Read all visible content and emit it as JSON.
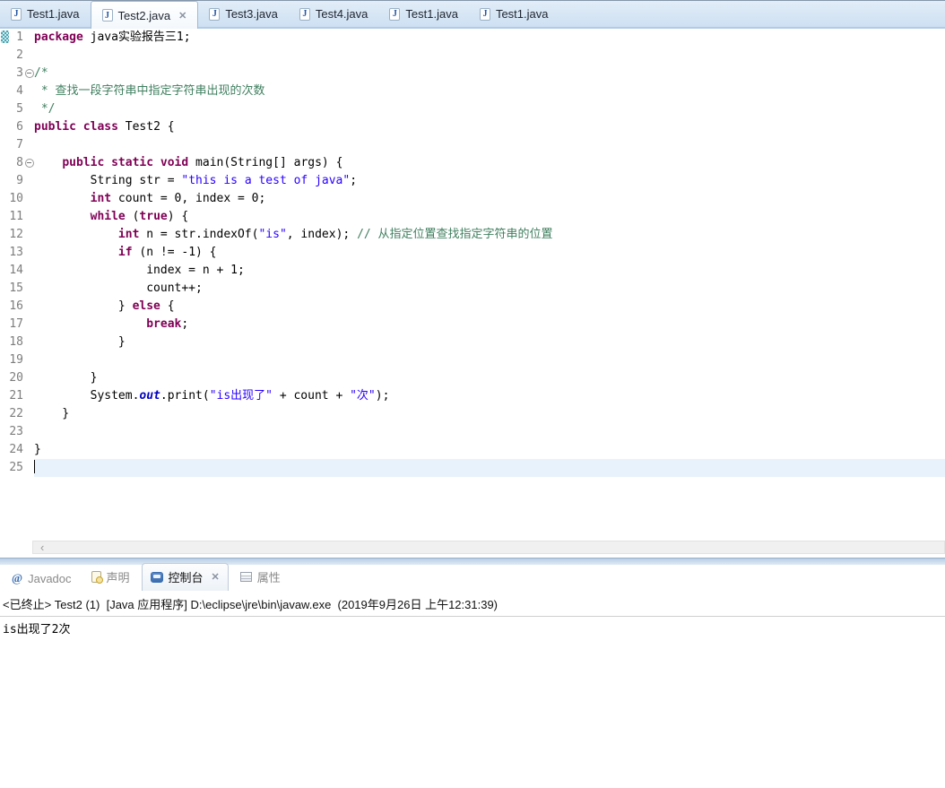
{
  "icons": {
    "close_glyph": "✕",
    "chevron_left_glyph": "‹",
    "java_file_glyph": "J",
    "javadoc_glyph": "@"
  },
  "colors": {
    "keyword": "#7f0055",
    "string": "#2a00ff",
    "comment": "#3f7f5f",
    "static_field": "#0000c0",
    "line_number": "#7d7d7d",
    "current_line_bg": "#e8f2fc",
    "tabbar_bg": "#cde0f2"
  },
  "editor_tabs": [
    {
      "label": "Test1.java",
      "active": false
    },
    {
      "label": "Test2.java",
      "active": true
    },
    {
      "label": "Test3.java",
      "active": false
    },
    {
      "label": "Test4.java",
      "active": false
    },
    {
      "label": "Test1.java",
      "active": false
    },
    {
      "label": "Test1.java",
      "active": false
    }
  ],
  "code": {
    "lines": [
      {
        "n": 1,
        "fold": false,
        "segs": [
          [
            "kw",
            "package"
          ],
          [
            "pl",
            " java实验报告三1;"
          ]
        ]
      },
      {
        "n": 2,
        "fold": false,
        "segs": []
      },
      {
        "n": 3,
        "fold": true,
        "segs": [
          [
            "com",
            "/*"
          ]
        ]
      },
      {
        "n": 4,
        "fold": false,
        "segs": [
          [
            "com",
            " * 查找一段字符串中指定字符串出现的次数"
          ]
        ]
      },
      {
        "n": 5,
        "fold": false,
        "segs": [
          [
            "com",
            " */"
          ]
        ]
      },
      {
        "n": 6,
        "fold": false,
        "segs": [
          [
            "kw",
            "public"
          ],
          [
            "pl",
            " "
          ],
          [
            "kw",
            "class"
          ],
          [
            "pl",
            " Test2 {"
          ]
        ]
      },
      {
        "n": 7,
        "fold": false,
        "segs": []
      },
      {
        "n": 8,
        "fold": true,
        "segs": [
          [
            "pl",
            "    "
          ],
          [
            "kw",
            "public"
          ],
          [
            "pl",
            " "
          ],
          [
            "kw",
            "static"
          ],
          [
            "pl",
            " "
          ],
          [
            "kw",
            "void"
          ],
          [
            "pl",
            " main(String[] args) {"
          ]
        ]
      },
      {
        "n": 9,
        "fold": false,
        "segs": [
          [
            "pl",
            "        String str = "
          ],
          [
            "str",
            "\"this is a test of java\""
          ],
          [
            "pl",
            ";"
          ]
        ]
      },
      {
        "n": 10,
        "fold": false,
        "segs": [
          [
            "pl",
            "        "
          ],
          [
            "kw",
            "int"
          ],
          [
            "pl",
            " count = 0, index = 0;"
          ]
        ]
      },
      {
        "n": 11,
        "fold": false,
        "segs": [
          [
            "pl",
            "        "
          ],
          [
            "kw",
            "while"
          ],
          [
            "pl",
            " ("
          ],
          [
            "kw",
            "true"
          ],
          [
            "pl",
            ") {"
          ]
        ]
      },
      {
        "n": 12,
        "fold": false,
        "segs": [
          [
            "pl",
            "            "
          ],
          [
            "kw",
            "int"
          ],
          [
            "pl",
            " n = str.indexOf("
          ],
          [
            "str",
            "\"is\""
          ],
          [
            "pl",
            ", index); "
          ],
          [
            "com",
            "// 从指定位置查找指定字符串的位置"
          ]
        ]
      },
      {
        "n": 13,
        "fold": false,
        "segs": [
          [
            "pl",
            "            "
          ],
          [
            "kw",
            "if"
          ],
          [
            "pl",
            " (n != -1) {"
          ]
        ]
      },
      {
        "n": 14,
        "fold": false,
        "segs": [
          [
            "pl",
            "                index = n + 1;"
          ]
        ]
      },
      {
        "n": 15,
        "fold": false,
        "segs": [
          [
            "pl",
            "                count++;"
          ]
        ]
      },
      {
        "n": 16,
        "fold": false,
        "segs": [
          [
            "pl",
            "            } "
          ],
          [
            "kw",
            "else"
          ],
          [
            "pl",
            " {"
          ]
        ]
      },
      {
        "n": 17,
        "fold": false,
        "segs": [
          [
            "pl",
            "                "
          ],
          [
            "kw",
            "break"
          ],
          [
            "pl",
            ";"
          ]
        ]
      },
      {
        "n": 18,
        "fold": false,
        "segs": [
          [
            "pl",
            "            }"
          ]
        ]
      },
      {
        "n": 19,
        "fold": false,
        "segs": []
      },
      {
        "n": 20,
        "fold": false,
        "segs": [
          [
            "pl",
            "        }"
          ]
        ]
      },
      {
        "n": 21,
        "fold": false,
        "segs": [
          [
            "pl",
            "        System."
          ],
          [
            "fld",
            "out"
          ],
          [
            "pl",
            ".print("
          ],
          [
            "str",
            "\"is出现了\""
          ],
          [
            "pl",
            " + count + "
          ],
          [
            "str",
            "\"次\""
          ],
          [
            "pl",
            ");"
          ]
        ]
      },
      {
        "n": 22,
        "fold": false,
        "segs": [
          [
            "pl",
            "    }"
          ]
        ]
      },
      {
        "n": 23,
        "fold": false,
        "segs": []
      },
      {
        "n": 24,
        "fold": false,
        "segs": [
          [
            "pl",
            "}"
          ]
        ]
      },
      {
        "n": 25,
        "fold": false,
        "current": true,
        "segs": []
      }
    ]
  },
  "panel": {
    "tabs": [
      {
        "label": "Javadoc",
        "icon": "javadoc-icon",
        "active": false
      },
      {
        "label": "声明",
        "icon": "declaration-icon",
        "active": false
      },
      {
        "label": "控制台",
        "icon": "console-icon",
        "active": true
      },
      {
        "label": "属性",
        "icon": "properties-icon",
        "active": false
      }
    ]
  },
  "console": {
    "title": "<已终止> Test2 (1)  [Java 应用程序] D:\\eclipse\\jre\\bin\\javaw.exe  (2019年9月26日 上午12:31:39)",
    "output": "is出现了2次"
  }
}
